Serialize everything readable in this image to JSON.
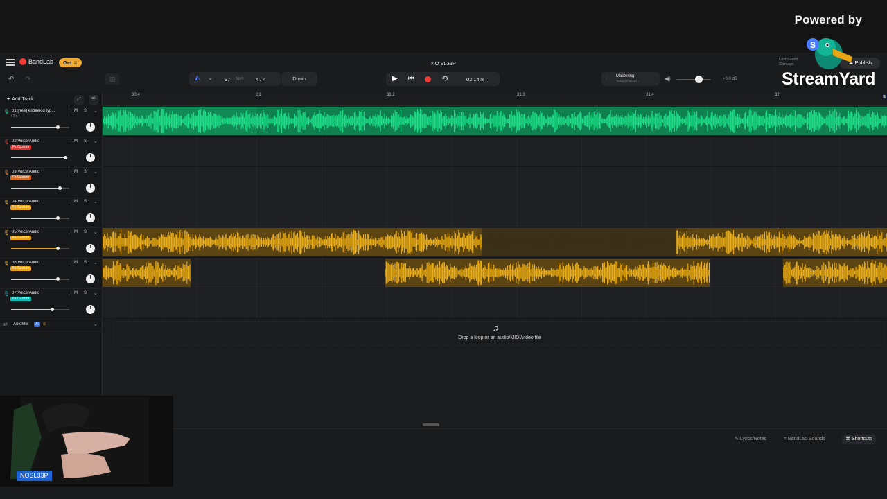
{
  "overlay": {
    "powered_by": "Powered by",
    "streamyard": "StreamYard",
    "name_tag": "NOSL33P"
  },
  "topbar": {
    "app_name": "BandLab",
    "get_label": "Get",
    "project_title": "NO SL33P",
    "last_saved_label": "Last Saved",
    "last_saved_ago": "22m ago",
    "live_label": "ive",
    "publish_label": "Publish"
  },
  "toolbar": {
    "bpm": "97",
    "bpm_unit": "bpm",
    "time_signature": "4 / 4",
    "key": "D min",
    "time": "02:14.8",
    "mastering_title": "Mastering",
    "mastering_preset": "Select Preset ›",
    "master_gain": "+0.0 dB",
    "master_volume": 0.64
  },
  "add_track_label": "Add Track",
  "ruler": {
    "marks": [
      "30.4",
      "31",
      "31.2",
      "31.3",
      "31.4",
      "32"
    ]
  },
  "colors": {
    "green": "#17c97a",
    "amber": "#e9a513",
    "amber_dim": "#5c4512",
    "red": "#e0322c",
    "orange": "#e0691c",
    "yellow": "#e9a513",
    "teal": "#0fb8b0"
  },
  "tracks": [
    {
      "number": "01",
      "name": "[free] esdeekid typ...",
      "fx": "+ Fx",
      "fx_color": "",
      "mic_color": "#17c97a",
      "volume": 0.8
    },
    {
      "number": "02",
      "name": "Voice/Audio",
      "fx": "Fx Custom",
      "fx_color": "#e0322c",
      "mic_color": "#e0322c",
      "volume": 0.93
    },
    {
      "number": "03",
      "name": "Voice/Audio",
      "fx": "Fx Custom",
      "fx_color": "#e0691c",
      "mic_color": "#e0691c",
      "volume": 0.83
    },
    {
      "number": "04",
      "name": "Voice/Audio",
      "fx": "Fx Custom",
      "fx_color": "#e9a513",
      "mic_color": "#e9a513",
      "volume": 0.8
    },
    {
      "number": "05",
      "name": "Voice/Audio",
      "fx": "Fx Custom",
      "fx_color": "#e9a513",
      "mic_color": "#e9a513",
      "volume": 0.8
    },
    {
      "number": "06",
      "name": "Voice/Audio",
      "fx": "Fx Custom",
      "fx_color": "#e9a513",
      "mic_color": "#e9a513",
      "volume": 0.8
    },
    {
      "number": "07",
      "name": "Voice/Audio",
      "fx": "Fx Custom",
      "fx_color": "#0fb8b0",
      "mic_color": "#0fb8b0",
      "volume": 0.7
    }
  ],
  "clip_label": "Voice/Audio",
  "automix": {
    "label": "AutoMix",
    "badge": "AI"
  },
  "dropzone_text": "Drop a loop or an audio/MIDI/video file",
  "footer": {
    "lyrics": "Lyrics/Notes",
    "sounds": "BandLab Sounds",
    "shortcuts": "Shortcuts"
  }
}
